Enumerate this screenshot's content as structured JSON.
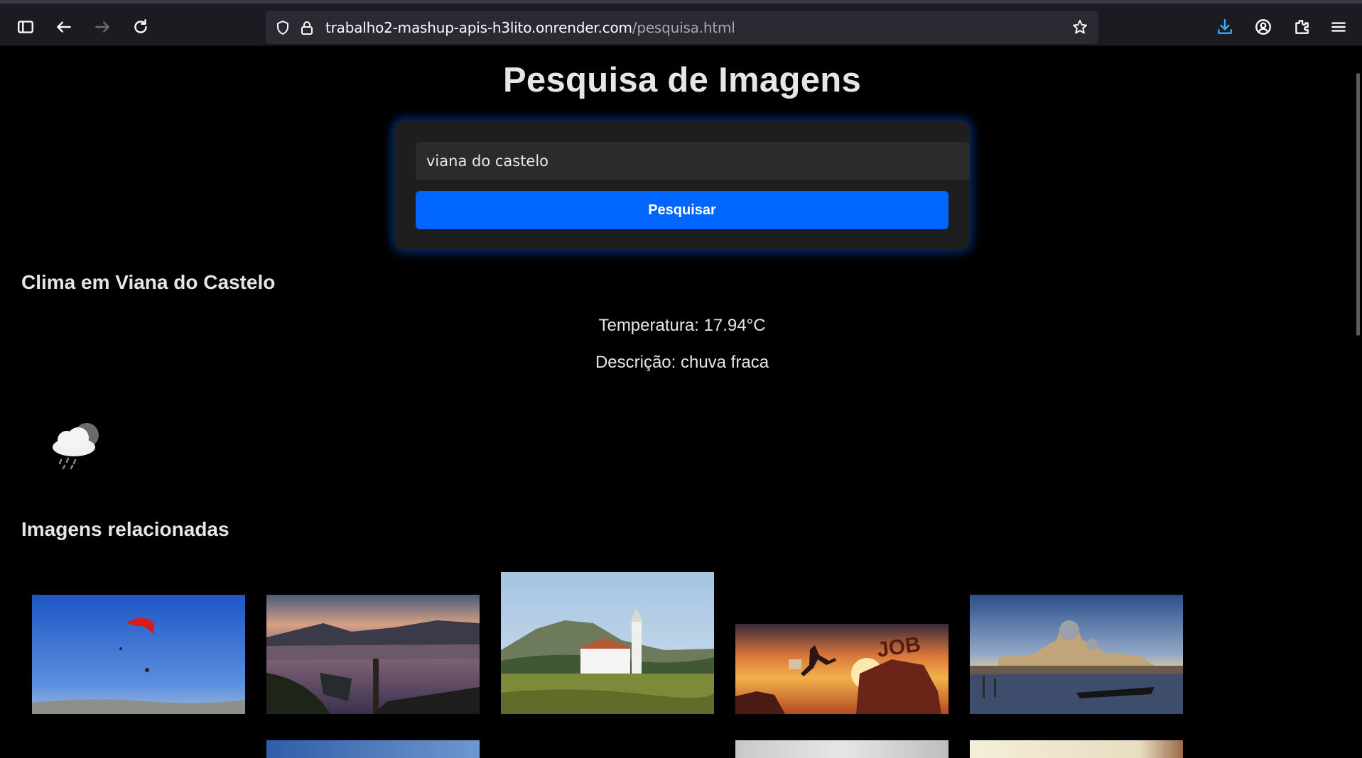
{
  "browser": {
    "url_host": "trabalho2-mashup-apis-h3lito.onrender.com",
    "url_path": "/pesquisa.html",
    "icons": [
      "sidebar-icon",
      "back-icon",
      "forward-icon",
      "reload-icon",
      "shield-icon",
      "lock-icon",
      "bookmark-star-icon",
      "downloads-icon",
      "account-icon",
      "extensions-icon",
      "menu-icon"
    ]
  },
  "page": {
    "title": "Pesquisa de Imagens",
    "search": {
      "value": "viana do castelo",
      "button_label": "Pesquisar"
    },
    "weather": {
      "heading": "Clima em Viana do Castelo",
      "temperature": "Temperatura: 17.94°C",
      "description": "Descrição: chuva fraca",
      "icon": "light-rain-cloud-icon"
    },
    "images": {
      "heading": "Imagens relacionadas",
      "items": [
        {
          "name": "paraglider-sky"
        },
        {
          "name": "river-sunset-boat"
        },
        {
          "name": "white-church-hills"
        },
        {
          "name": "job-jump-sunset"
        },
        {
          "name": "venice-santa-maria"
        },
        {
          "name": "partial-blue-sky"
        },
        {
          "name": "partial-grey"
        },
        {
          "name": "partial-beige"
        }
      ]
    }
  },
  "colors": {
    "accent": "#0066ff",
    "background": "#000000",
    "card": "#1e1e1e"
  }
}
